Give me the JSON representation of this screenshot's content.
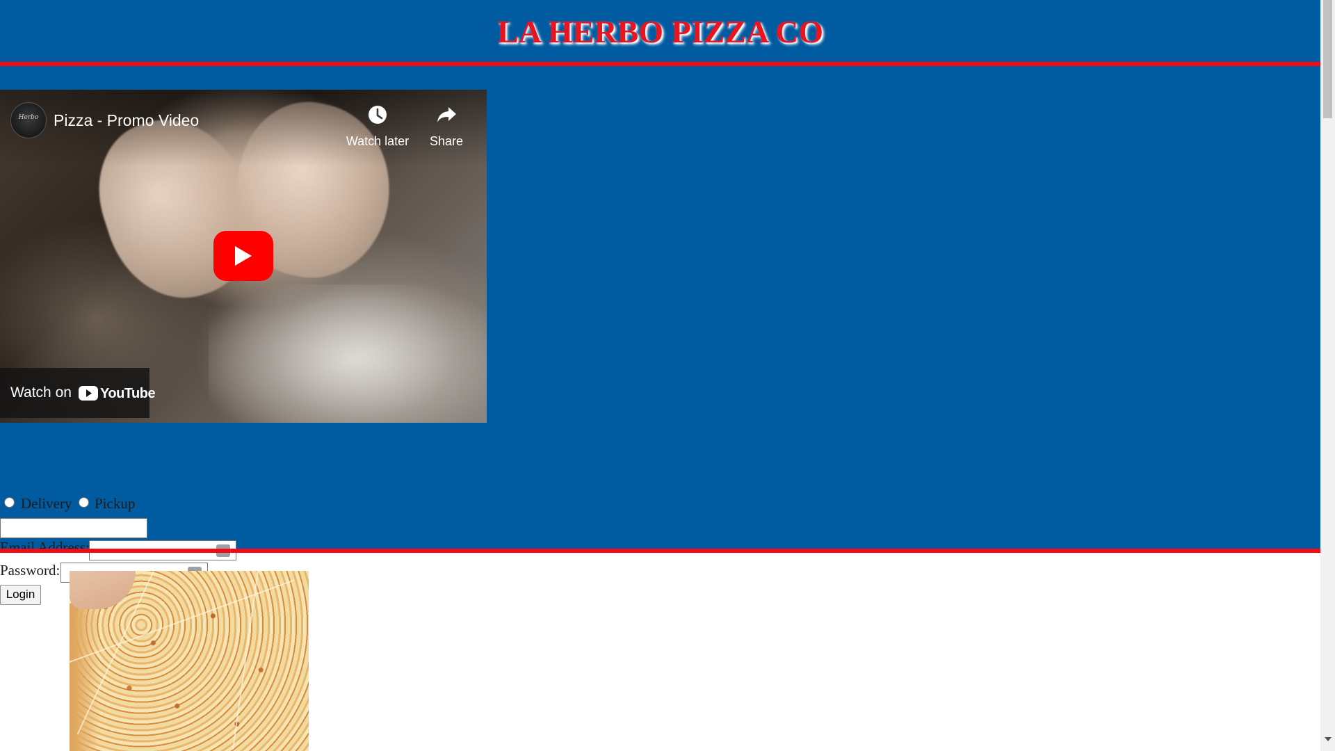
{
  "header": {
    "title": "LA HERBO PIZZA CO"
  },
  "video": {
    "title": "Pizza - Promo Video",
    "watch_later_label": "Watch later",
    "share_label": "Share",
    "watch_on_label": "Watch on",
    "youtube_wordmark": "YouTube",
    "channel_logo_text": "Herbo"
  },
  "order_form": {
    "delivery_label": "Delivery",
    "pickup_label": "Pickup",
    "address_value": "",
    "email_label": "Email Address:",
    "email_value": "",
    "password_label": "Password:",
    "password_value": "",
    "login_label": "Login"
  },
  "colors": {
    "header_background": "#005ba1",
    "title_red": "#e8141f",
    "divider_red": "#f20a16",
    "youtube_red": "#ff0000"
  },
  "icons": {
    "watch_later": "clock-icon",
    "share": "share-arrow-icon",
    "play": "play-icon",
    "youtube": "youtube-logo-icon",
    "autofill": "autofill-key-icon"
  }
}
